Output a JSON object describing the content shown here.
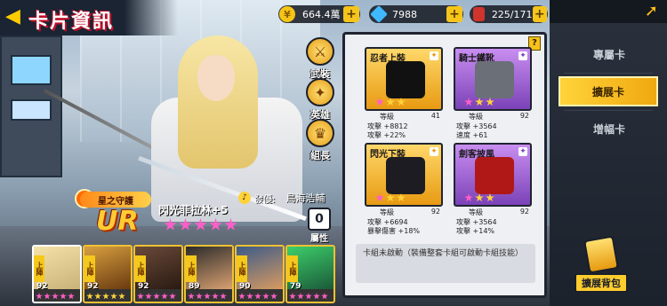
{
  "header": {
    "title": "卡片資訊",
    "back_icon": "back-arrow-icon"
  },
  "currency": {
    "gold": {
      "value": "664.4萬",
      "icon": "coin-icon"
    },
    "gems": {
      "value": "7988",
      "icon": "diamond-icon"
    },
    "cards": {
      "value": "225/171",
      "icon": "card-icon"
    },
    "plus_label": "+"
  },
  "side_actions": {
    "equipment": "武裝",
    "hero": "英雄",
    "leader": "組長",
    "attribute": "屬性"
  },
  "character": {
    "faction": "星之守護",
    "rarity": "UR",
    "name": "閃光菲拉林+5",
    "stars": 5,
    "voice_label": "發優:",
    "voice_actor": "鳥海浩輔"
  },
  "strip": [
    {
      "tag": "上陣",
      "level": "92",
      "colors": [
        "#f5e2a8",
        "#c9b27a"
      ],
      "stars": 5,
      "star_color": "p"
    },
    {
      "tag": "上陣",
      "level": "92",
      "colors": [
        "#d8a040",
        "#6a3a10"
      ],
      "stars": 5,
      "star_color": "y"
    },
    {
      "tag": "上陣",
      "level": "92",
      "colors": [
        "#6a4a3a",
        "#2a1a12"
      ],
      "stars": 5,
      "star_color": "p"
    },
    {
      "tag": "上陣",
      "level": "89",
      "colors": [
        "#2a2a2a",
        "#d8a070"
      ],
      "stars": 5,
      "star_color": "p"
    },
    {
      "tag": "上陣",
      "level": "90",
      "colors": [
        "#3a5a8a",
        "#d89a60"
      ],
      "stars": 5,
      "star_color": "p"
    },
    {
      "tag": "上陣",
      "level": "79",
      "colors": [
        "#3ecf6a",
        "#1a5a3a"
      ],
      "stars": 5,
      "star_color": "p"
    }
  ],
  "gear": [
    {
      "name": "忍者上裝",
      "level_label": "等級",
      "level": "41",
      "stat1": "攻擊 +8812",
      "stat2": "攻擊 +22%",
      "theme": "orange",
      "stars": 3,
      "item_color": "#111"
    },
    {
      "name": "騎士鐵靴",
      "level_label": "等級",
      "level": "92",
      "stat1": "攻擊 +3564",
      "stat2": "速度 +61",
      "theme": "purple",
      "stars": 3,
      "item_color": "#6a6f78"
    },
    {
      "name": "閃光下裝",
      "level_label": "等級",
      "level": "92",
      "stat1": "攻擊 +6694",
      "stat2": "暴擊傷害 +18%",
      "theme": "orange",
      "stars": 3,
      "item_color": "#1c1c22"
    },
    {
      "name": "劍客披風",
      "level_label": "等級",
      "level": "92",
      "stat1": "攻擊 +3564",
      "stat2": "攻擊 +14%",
      "theme": "purple",
      "stars": 3,
      "item_color": "#b01818"
    }
  ],
  "set_description": "卡組未啟動（裝備整套卡組可啟動卡組技能）",
  "tabs": [
    {
      "label": "專屬卡",
      "active": false
    },
    {
      "label": "擴展卡",
      "active": true
    },
    {
      "label": "增幅卡",
      "active": false
    }
  ],
  "bag": {
    "label_1": "擴展",
    "label_2": "背包"
  },
  "colors": {
    "accent": "#f6c51b",
    "panel_border": "#1f2430",
    "rarity": "#ffcc33"
  }
}
